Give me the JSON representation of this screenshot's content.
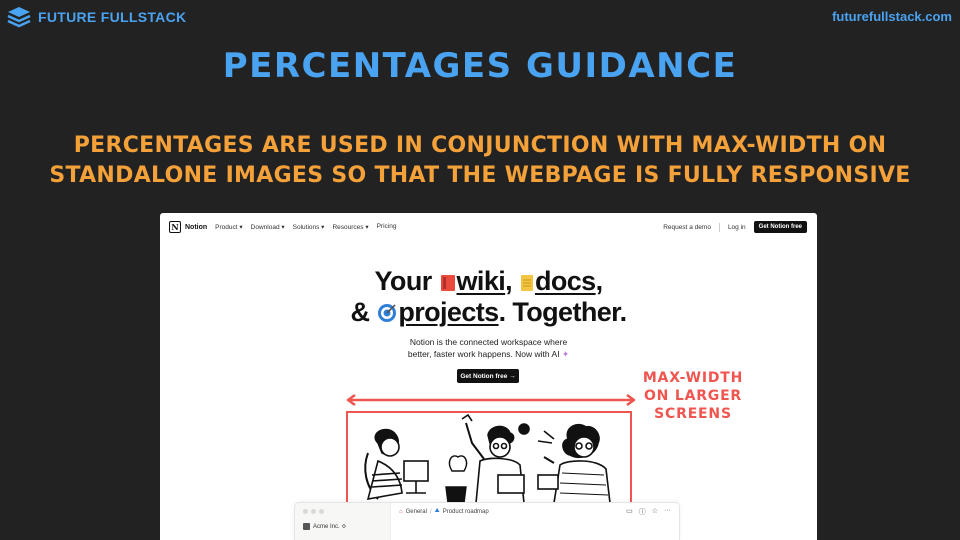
{
  "header": {
    "brand": "FUTURE FULLSTACK",
    "url": "futurefullstack.com"
  },
  "slide": {
    "title": "PERCENTAGES GUIDANCE",
    "subtitle_line1": "PERCENTAGES ARE USED IN CONJUNCTION WITH MAX-WIDTH ON",
    "subtitle_line2": "STANDALONE IMAGES SO THAT THE WEBPAGE IS FULLY RESPONSIVE"
  },
  "screenshot": {
    "nav": {
      "logo_letter": "N",
      "logo_text": "Notion",
      "links": [
        "Product ▾",
        "Download ▾",
        "Solutions ▾",
        "Resources ▾",
        "Pricing"
      ],
      "request_demo": "Request a demo",
      "login": "Log in",
      "cta": "Get Notion free"
    },
    "hero": {
      "w_your": "Your ",
      "w_wiki": "wiki",
      "w_comma": ", ",
      "w_docs": "docs",
      "w_comma2": ",",
      "w_amp": "& ",
      "w_projects": "projects",
      "w_together": ". Together.",
      "desc1": "Notion is the connected workspace where",
      "desc2": "better, faster work happens. Now with AI",
      "sparkle": "✦",
      "cta": "Get Notion free →"
    },
    "annotation": {
      "line1": "MAX-WIDTH",
      "line2": "ON LARGER",
      "line3": "SCREENS"
    },
    "mock": {
      "workspace": "Acme Inc. ≎",
      "breadcrumb_1": "General",
      "breadcrumb_sep": "/",
      "breadcrumb_2": "Product roadmap",
      "more": "···"
    }
  },
  "colors": {
    "background": "#222222",
    "title_blue": "#4aa3f0",
    "subtitle_orange": "#f5a13a",
    "annotation_red": "#f05650"
  }
}
